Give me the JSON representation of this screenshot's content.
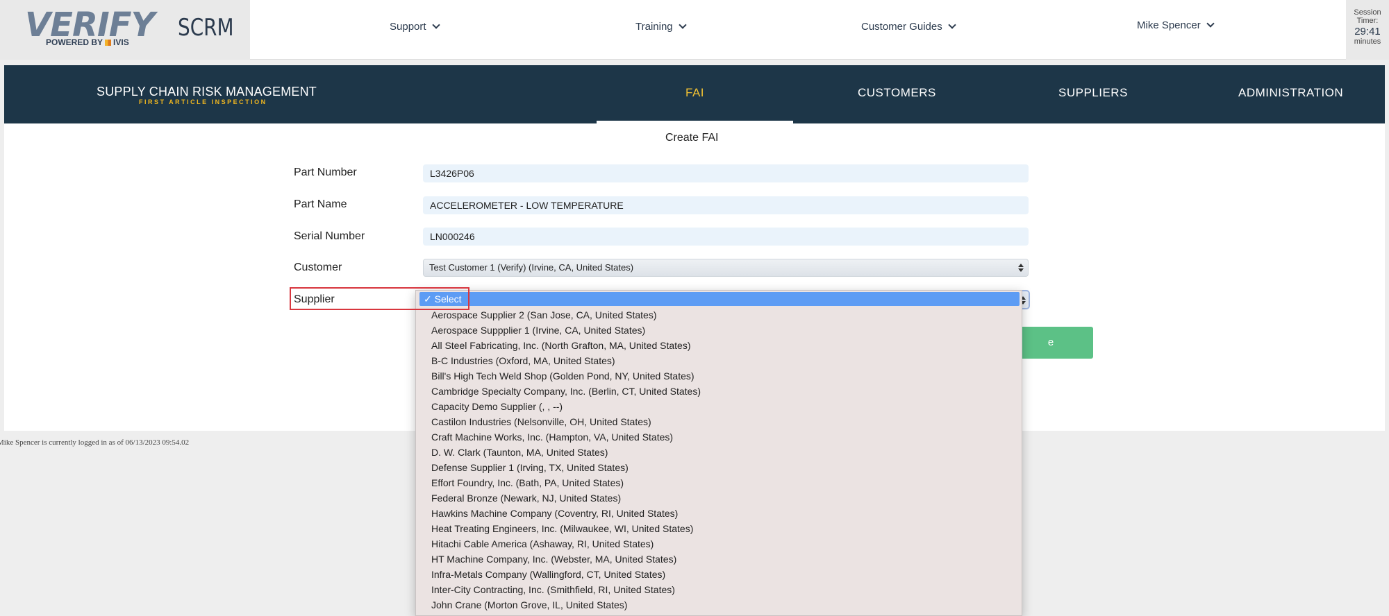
{
  "header": {
    "logo_text": "VERIFY",
    "logo_sub_left": "POWERED BY",
    "logo_sub_right": "IVIS",
    "app_short": "SCRM",
    "nav": [
      {
        "label": "Support"
      },
      {
        "label": "Training"
      },
      {
        "label": "Customer Guides"
      }
    ],
    "user": "Mike Spencer",
    "timer": {
      "label": "Session Timer:",
      "value": "29:41",
      "unit": "minutes"
    }
  },
  "mainnav": {
    "title": "SUPPLY CHAIN RISK MANAGEMENT",
    "subtitle": "FIRST ARTICLE INSPECTION",
    "items": [
      {
        "label": "FAI",
        "active": true
      },
      {
        "label": "CUSTOMERS"
      },
      {
        "label": "SUPPLIERS"
      },
      {
        "label": "ADMINISTRATION"
      }
    ]
  },
  "form": {
    "title": "Create FAI",
    "part_number": {
      "label": "Part Number",
      "value": "L3426P06"
    },
    "part_name": {
      "label": "Part Name",
      "value": "ACCELEROMETER - LOW TEMPERATURE"
    },
    "serial_number": {
      "label": "Serial Number",
      "value": "LN000246"
    },
    "customer": {
      "label": "Customer",
      "value": "Test Customer 1 (Verify) (Irvine, CA, United States)"
    },
    "supplier": {
      "label": "Supplier",
      "selected": "✓ Select",
      "options": [
        "Aerospace Supplier 2 (San Jose, CA, United States)",
        "Aerospace Suppplier 1 (Irvine, CA, United States)",
        "All Steel Fabricating, Inc. (North Grafton, MA, United States)",
        "B-C Industries (Oxford, MA, United States)",
        "Bill's High Tech Weld Shop (Golden Pond, NY, United States)",
        "Cambridge Specialty Company, Inc. (Berlin, CT, United States)",
        "Capacity Demo Supplier (, , --)",
        "Castilon Industries (Nelsonville, OH, United States)",
        "Craft Machine Works, Inc. (Hampton, VA, United States)",
        "D. W. Clark (Taunton, MA, United States)",
        "Defense Supplier 1 (Irving, TX, United States)",
        "Effort Foundry, Inc. (Bath, PA, United States)",
        "Federal Bronze (Newark, NJ, United States)",
        "Hawkins Machine Company (Coventry, RI, United States)",
        "Heat Treating Engineers, Inc. (Milwaukee, WI, United States)",
        "Hitachi Cable America (Ashaway, RI, United States)",
        "HT Machine Company, Inc. (Webster, MA, United States)",
        "Infra-Metals Company (Wallingford, CT, United States)",
        "Inter-City Contracting, Inc. (Smithfield, RI, United States)",
        "John Crane (Morton Grove, IL, United States)"
      ]
    },
    "create_button": "e"
  },
  "footer": {
    "status": "Mike Spencer is currently logged in as of 06/13/2023 09:54.02"
  },
  "colors": {
    "navbar": "#1d3648",
    "active_nav": "#f2c233",
    "create_button": "#5cc186",
    "dropdown_highlight": "#5d9cf4",
    "annotation_box": "#d8363e"
  }
}
